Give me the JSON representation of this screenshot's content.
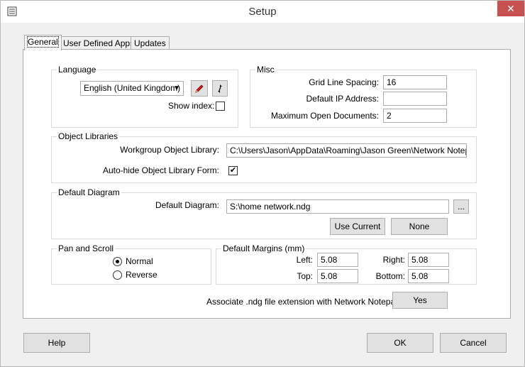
{
  "window": {
    "title": "Setup",
    "close_glyph": "✕"
  },
  "tabs": [
    {
      "label": "General"
    },
    {
      "label": "User Defined Apps"
    },
    {
      "label": "Updates"
    }
  ],
  "language": {
    "group_label": "Language",
    "selected": "English (United Kingdom)",
    "show_index_label": "Show index:",
    "show_index_checked": false
  },
  "misc": {
    "group_label": "Misc",
    "grid_line_spacing_label": "Grid Line Spacing:",
    "grid_line_spacing_value": "16",
    "default_ip_label": "Default IP Address:",
    "default_ip_value": "",
    "max_open_docs_label": "Maximum Open Documents:",
    "max_open_docs_value": "2"
  },
  "object_libraries": {
    "group_label": "Object Libraries",
    "workgroup_label": "Workgroup Object Library:",
    "workgroup_value": "C:\\Users\\Jason\\AppData\\Roaming\\Jason Green\\Network Notepad F",
    "autohide_label": "Auto-hide Object Library Form:",
    "autohide_checked": true,
    "check_glyph": "✔"
  },
  "default_diagram": {
    "group_label": "Default Diagram",
    "diagram_label": "Default Diagram:",
    "diagram_value": "S:\\home network.ndg",
    "browse_label": "...",
    "use_current_label": "Use Current",
    "none_label": "None"
  },
  "pan_scroll": {
    "group_label": "Pan and Scroll",
    "normal_label": "Normal",
    "reverse_label": "Reverse",
    "selected": "Normal"
  },
  "margins": {
    "group_label": "Default Margins (mm)",
    "left_label": "Left:",
    "left_value": "5.08",
    "right_label": "Right:",
    "right_value": "5.08",
    "top_label": "Top:",
    "top_value": "5.08",
    "bottom_label": "Bottom:",
    "bottom_value": "5.08"
  },
  "associate": {
    "label": "Associate .ndg file extension with Network Notepad?",
    "button_label": "Yes"
  },
  "footer": {
    "help_label": "Help",
    "ok_label": "OK",
    "cancel_label": "Cancel"
  },
  "colors": {
    "close_button": "#c75050",
    "edit_icon": "#d21e1e"
  }
}
